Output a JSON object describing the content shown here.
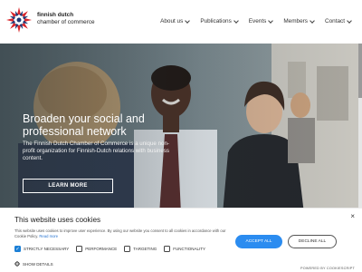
{
  "header": {
    "brand_line1": "finnish dutch",
    "brand_line2": "chamber of commerce",
    "nav": [
      {
        "label": "About us"
      },
      {
        "label": "Publications"
      },
      {
        "label": "Events"
      },
      {
        "label": "Members"
      },
      {
        "label": "Contact"
      }
    ]
  },
  "hero": {
    "title": "Broaden your social and professional network",
    "text": "The Finnish Dutch Chamber of Commerce is a unique non-profit organization for Finnish-Dutch relations with business content.",
    "button": "LEARN MORE"
  },
  "cookie_banner": {
    "title": "This website uses cookies",
    "text": "This website uses cookies to improve user experience. By using our website you consent to all cookies in accordance with our Cookie Policy.",
    "read_more": "Read more",
    "close": "×",
    "options": [
      {
        "label": "STRICTLY NECESSARY",
        "checked": true
      },
      {
        "label": "PERFORMANCE",
        "checked": false
      },
      {
        "label": "TARGETING",
        "checked": false
      },
      {
        "label": "FUNCTIONALITY",
        "checked": false
      }
    ],
    "show_details": "SHOW DETAILS",
    "accept": "ACCEPT ALL",
    "decline": "DECLINE ALL",
    "powered_by": "POWERED BY COOKIESCRIPT"
  },
  "colors": {
    "accent_blue": "#2b8cf0",
    "checkbox_blue": "#1b7fd6",
    "logo_red": "#d9262b",
    "logo_navy": "#1f3a78"
  }
}
